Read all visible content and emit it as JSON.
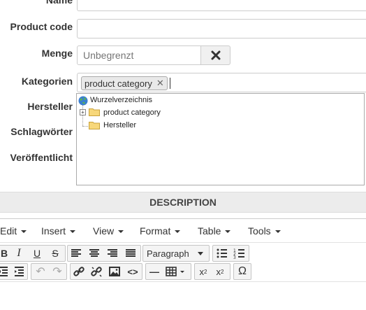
{
  "form": {
    "name_label": "Name",
    "product_code_label": "Product code",
    "menge_label": "Menge",
    "menge_placeholder": "Unbegrenzt",
    "kategorien_label": "Kategorien",
    "hersteller_label": "Hersteller",
    "schlagwoerter_label": "Schlagwörter",
    "veroeffentlicht_label": "Veröffentlicht",
    "category_tag": "product category"
  },
  "tree": {
    "root": "Wurzelverzeichnis",
    "items": [
      "product category",
      "Hersteller"
    ]
  },
  "description": {
    "title": "DESCRIPTION"
  },
  "editor": {
    "menu": [
      "Edit",
      "Insert",
      "View",
      "Format",
      "Table",
      "Tools"
    ],
    "format_select": "Paragraph"
  }
}
